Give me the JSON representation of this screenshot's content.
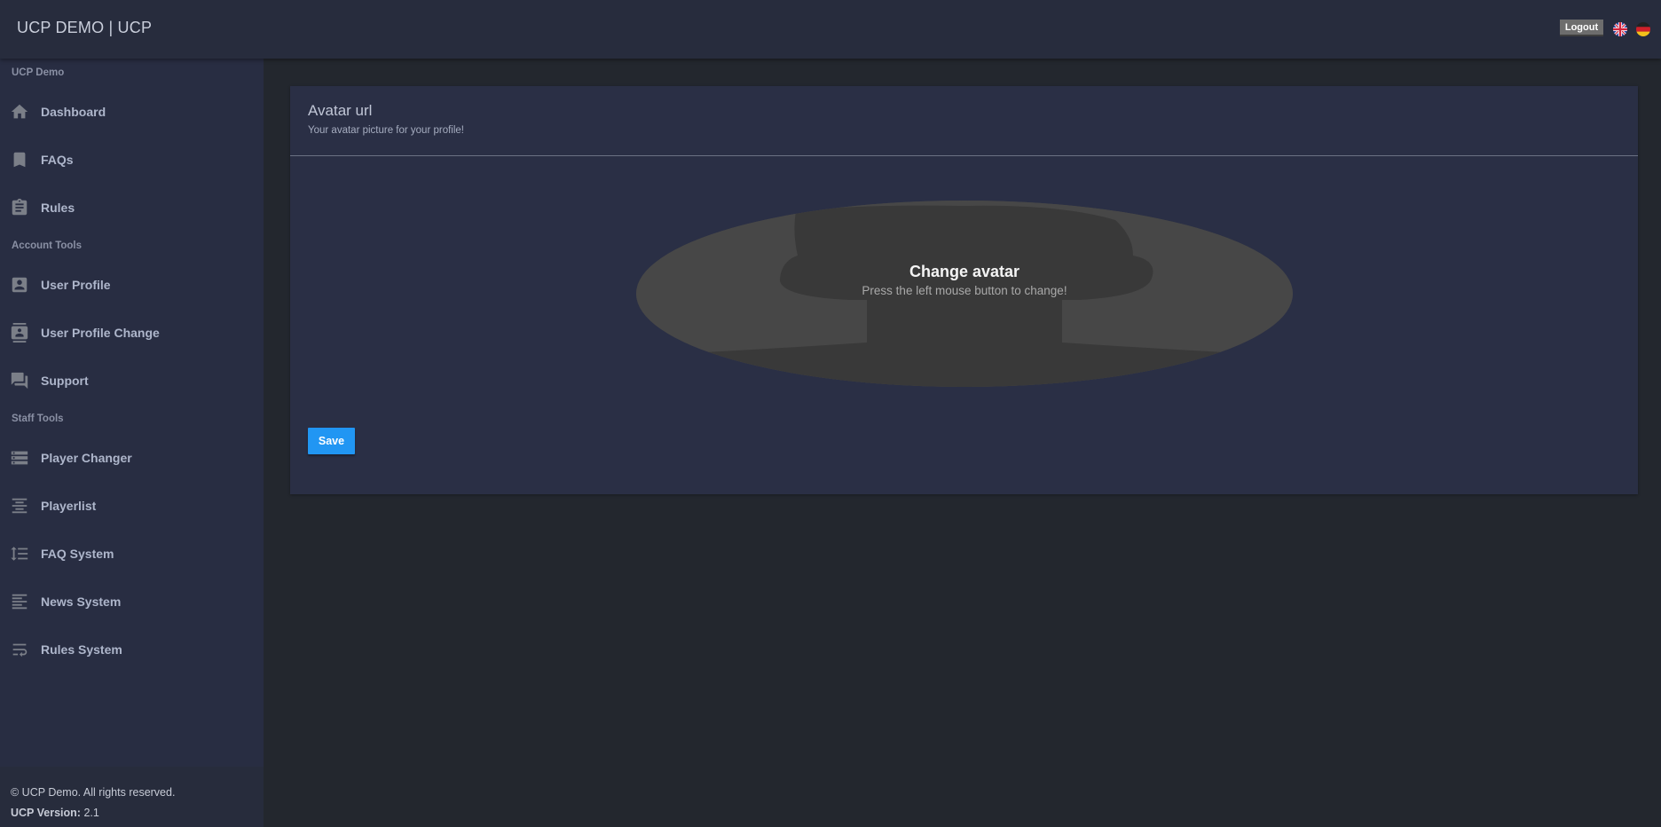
{
  "header": {
    "brand": "UCP DEMO | UCP",
    "logout_label": "Logout",
    "languages": [
      {
        "name": "english-flag-icon",
        "code": "en"
      },
      {
        "name": "german-flag-icon",
        "code": "de"
      }
    ]
  },
  "sidebar": {
    "sections": [
      {
        "label": "UCP Demo"
      },
      {
        "label": "Account Tools"
      },
      {
        "label": "Staff Tools"
      }
    ],
    "items": [
      {
        "label": "Dashboard",
        "icon": "home-icon"
      },
      {
        "label": "FAQs",
        "icon": "bookmark-icon"
      },
      {
        "label": "Rules",
        "icon": "clipboard-icon"
      },
      {
        "label": "User Profile",
        "icon": "account-box-icon"
      },
      {
        "label": "User Profile Change",
        "icon": "contacts-icon"
      },
      {
        "label": "Support",
        "icon": "forum-icon"
      },
      {
        "label": "Player Changer",
        "icon": "storage-icon"
      },
      {
        "label": "Playerlist",
        "icon": "align-center-icon"
      },
      {
        "label": "FAQ System",
        "icon": "line-spacing-icon"
      },
      {
        "label": "News System",
        "icon": "align-left-icon"
      },
      {
        "label": "Rules System",
        "icon": "wrap-text-icon"
      }
    ],
    "footer": {
      "copyright": "© UCP Demo. All rights reserved.",
      "version_label": "UCP Version:",
      "version_value": "2.1"
    }
  },
  "card": {
    "title": "Avatar url",
    "subtitle": "Your avatar picture for your profile!",
    "avatar_title": "Change avatar",
    "avatar_hint": "Press the left mouse button to change!",
    "save_label": "Save"
  },
  "colors": {
    "background": "#23272e",
    "topbar": "#272c3d",
    "sidebar": "#282d42",
    "card": "#2a2f45",
    "accent": "#2196f3",
    "nav_text": "#aeb6cb",
    "icon": "#7b7f88"
  }
}
